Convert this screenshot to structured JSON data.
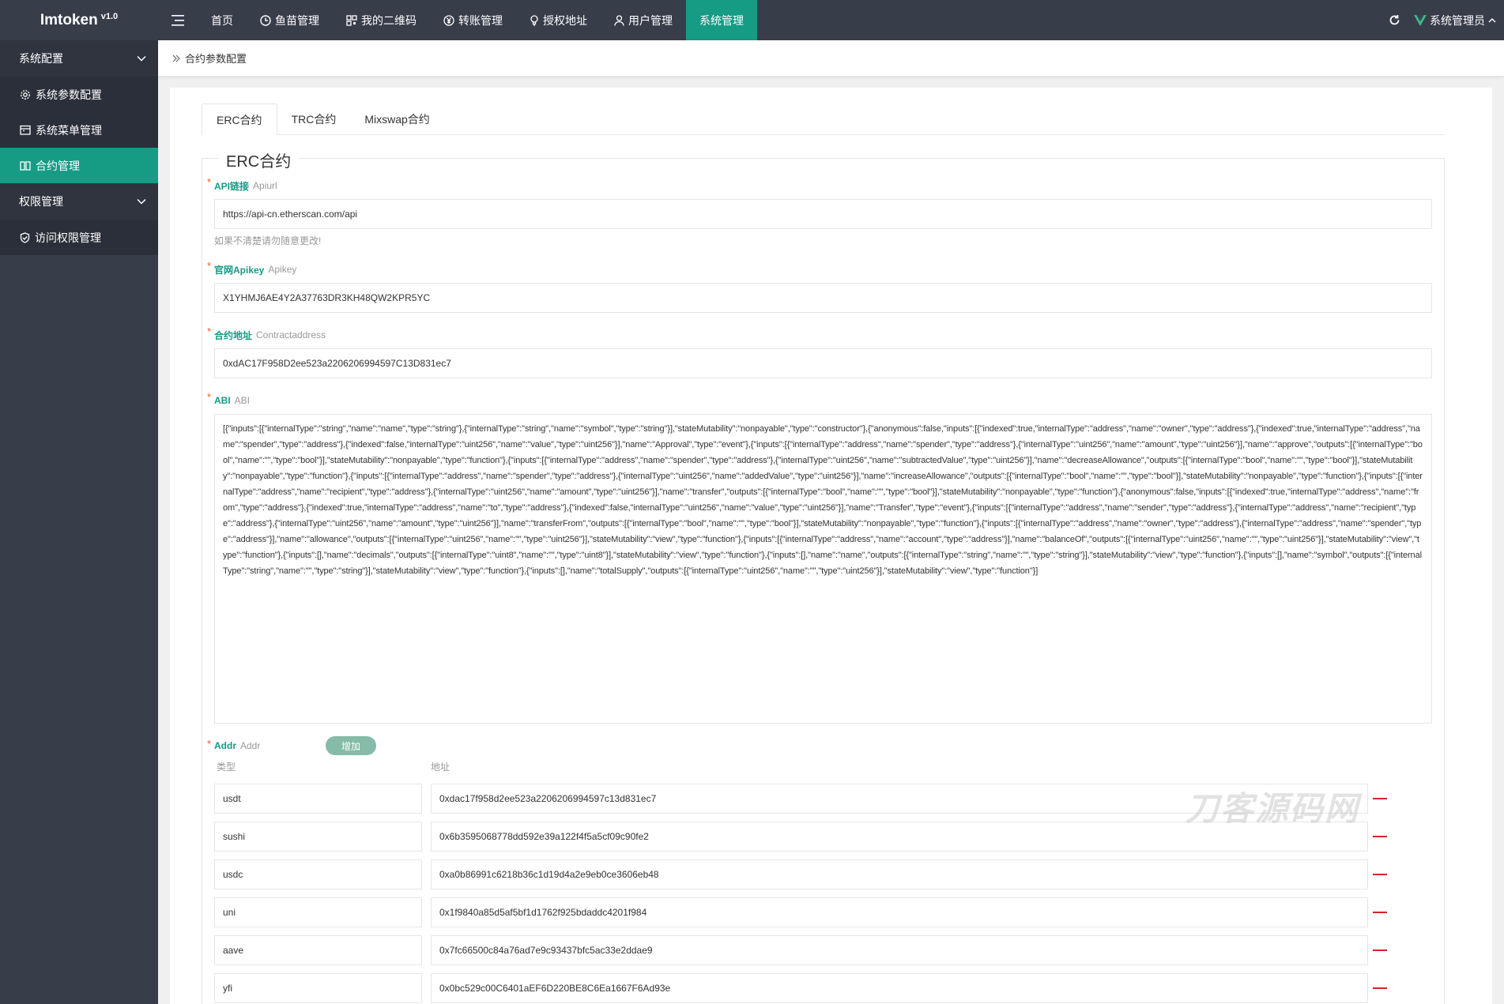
{
  "app": {
    "brand": "Imtoken",
    "version": "v1.0"
  },
  "topnav": {
    "items": [
      {
        "label": "首页"
      },
      {
        "label": "鱼苗管理"
      },
      {
        "label": "我的二维码"
      },
      {
        "label": "转账管理"
      },
      {
        "label": "授权地址"
      },
      {
        "label": "用户管理"
      },
      {
        "label": "系统管理"
      }
    ],
    "user": "系统管理员"
  },
  "sidebar": {
    "group1": "系统配置",
    "items1": [
      {
        "label": "系统参数配置"
      },
      {
        "label": "系统菜单管理"
      },
      {
        "label": "合约管理"
      }
    ],
    "group2": "权限管理",
    "items2": [
      {
        "label": "访问权限管理"
      }
    ]
  },
  "breadcrumb": "合约参数配置",
  "tabs": [
    {
      "label": "ERC合约"
    },
    {
      "label": "TRC合约"
    },
    {
      "label": "Mixswap合约"
    }
  ],
  "form": {
    "legend": "ERC合约",
    "api": {
      "label": "API链接",
      "label_en": "Apiurl",
      "value": "https://api-cn.etherscan.com/api",
      "hint": "如果不清楚请勿随意更改!"
    },
    "apikey": {
      "label": "官网Apikey",
      "label_en": "Apikey",
      "value": "X1YHMJ6AE4Y2A37763DR3KH48QW2KPR5YC"
    },
    "contract": {
      "label": "合约地址",
      "label_en": "Contractaddress",
      "value": "0xdAC17F958D2ee523a2206206994597C13D831ec7"
    },
    "abi": {
      "label": "ABI",
      "label_en": "ABI",
      "value": "[{\"inputs\":[{\"internalType\":\"string\",\"name\":\"name\",\"type\":\"string\"},{\"internalType\":\"string\",\"name\":\"symbol\",\"type\":\"string\"}],\"stateMutability\":\"nonpayable\",\"type\":\"constructor\"},{\"anonymous\":false,\"inputs\":[{\"indexed\":true,\"internalType\":\"address\",\"name\":\"owner\",\"type\":\"address\"},{\"indexed\":true,\"internalType\":\"address\",\"name\":\"spender\",\"type\":\"address\"},{\"indexed\":false,\"internalType\":\"uint256\",\"name\":\"value\",\"type\":\"uint256\"}],\"name\":\"Approval\",\"type\":\"event\"},{\"inputs\":[{\"internalType\":\"address\",\"name\":\"spender\",\"type\":\"address\"},{\"internalType\":\"uint256\",\"name\":\"amount\",\"type\":\"uint256\"}],\"name\":\"approve\",\"outputs\":[{\"internalType\":\"bool\",\"name\":\"\",\"type\":\"bool\"}],\"stateMutability\":\"nonpayable\",\"type\":\"function\"},{\"inputs\":[{\"internalType\":\"address\",\"name\":\"spender\",\"type\":\"address\"},{\"internalType\":\"uint256\",\"name\":\"subtractedValue\",\"type\":\"uint256\"}],\"name\":\"decreaseAllowance\",\"outputs\":[{\"internalType\":\"bool\",\"name\":\"\",\"type\":\"bool\"}],\"stateMutability\":\"nonpayable\",\"type\":\"function\"},{\"inputs\":[{\"internalType\":\"address\",\"name\":\"spender\",\"type\":\"address\"},{\"internalType\":\"uint256\",\"name\":\"addedValue\",\"type\":\"uint256\"}],\"name\":\"increaseAllowance\",\"outputs\":[{\"internalType\":\"bool\",\"name\":\"\",\"type\":\"bool\"}],\"stateMutability\":\"nonpayable\",\"type\":\"function\"},{\"inputs\":[{\"internalType\":\"address\",\"name\":\"recipient\",\"type\":\"address\"},{\"internalType\":\"uint256\",\"name\":\"amount\",\"type\":\"uint256\"}],\"name\":\"transfer\",\"outputs\":[{\"internalType\":\"bool\",\"name\":\"\",\"type\":\"bool\"}],\"stateMutability\":\"nonpayable\",\"type\":\"function\"},{\"anonymous\":false,\"inputs\":[{\"indexed\":true,\"internalType\":\"address\",\"name\":\"from\",\"type\":\"address\"},{\"indexed\":true,\"internalType\":\"address\",\"name\":\"to\",\"type\":\"address\"},{\"indexed\":false,\"internalType\":\"uint256\",\"name\":\"value\",\"type\":\"uint256\"}],\"name\":\"Transfer\",\"type\":\"event\"},{\"inputs\":[{\"internalType\":\"address\",\"name\":\"sender\",\"type\":\"address\"},{\"internalType\":\"address\",\"name\":\"recipient\",\"type\":\"address\"},{\"internalType\":\"uint256\",\"name\":\"amount\",\"type\":\"uint256\"}],\"name\":\"transferFrom\",\"outputs\":[{\"internalType\":\"bool\",\"name\":\"\",\"type\":\"bool\"}],\"stateMutability\":\"nonpayable\",\"type\":\"function\"},{\"inputs\":[{\"internalType\":\"address\",\"name\":\"owner\",\"type\":\"address\"},{\"internalType\":\"address\",\"name\":\"spender\",\"type\":\"address\"}],\"name\":\"allowance\",\"outputs\":[{\"internalType\":\"uint256\",\"name\":\"\",\"type\":\"uint256\"}],\"stateMutability\":\"view\",\"type\":\"function\"},{\"inputs\":[{\"internalType\":\"address\",\"name\":\"account\",\"type\":\"address\"}],\"name\":\"balanceOf\",\"outputs\":[{\"internalType\":\"uint256\",\"name\":\"\",\"type\":\"uint256\"}],\"stateMutability\":\"view\",\"type\":\"function\"},{\"inputs\":[],\"name\":\"decimals\",\"outputs\":[{\"internalType\":\"uint8\",\"name\":\"\",\"type\":\"uint8\"}],\"stateMutability\":\"view\",\"type\":\"function\"},{\"inputs\":[],\"name\":\"name\",\"outputs\":[{\"internalType\":\"string\",\"name\":\"\",\"type\":\"string\"}],\"stateMutability\":\"view\",\"type\":\"function\"},{\"inputs\":[],\"name\":\"symbol\",\"outputs\":[{\"internalType\":\"string\",\"name\":\"\",\"type\":\"string\"}],\"stateMutability\":\"view\",\"type\":\"function\"},{\"inputs\":[],\"name\":\"totalSupply\",\"outputs\":[{\"internalType\":\"uint256\",\"name\":\"\",\"type\":\"uint256\"}],\"stateMutability\":\"view\",\"type\":\"function\"}]"
    },
    "addr": {
      "label": "Addr",
      "label_en": "Addr",
      "add_button": "增加",
      "col_type": "类型",
      "col_addr": "地址",
      "rows": [
        {
          "type": "usdt",
          "addr": "0xdac17f958d2ee523a2206206994597c13d831ec7"
        },
        {
          "type": "sushi",
          "addr": "0x6b3595068778dd592e39a122f4f5a5cf09c90fe2"
        },
        {
          "type": "usdc",
          "addr": "0xa0b86991c6218b36c1d19d4a2e9eb0ce3606eb48"
        },
        {
          "type": "uni",
          "addr": "0x1f9840a85d5af5bf1d1762f925bdaddc4201f984"
        },
        {
          "type": "aave",
          "addr": "0x7fc66500c84a76ad7e9c93437bfc5ac33e2ddae9"
        },
        {
          "type": "yfi",
          "addr": "0x0bc529c00C6401aEF6D220BE8C6Ea1667F6Ad93e"
        }
      ]
    }
  },
  "watermark": "刀客源码网",
  "colors": {
    "accent": "#169b85",
    "nav_bg": "#383d4a",
    "danger": "#e02020"
  }
}
